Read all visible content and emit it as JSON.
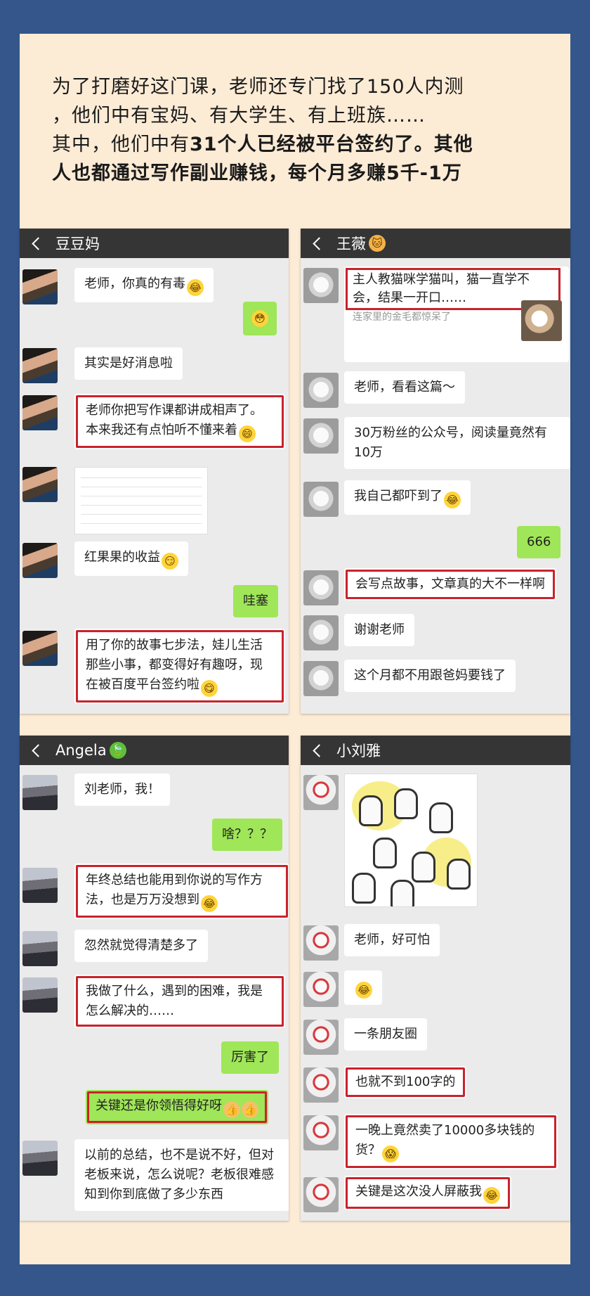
{
  "headline": {
    "line1": "为了打磨好这门课，老师还专门找了150人内测",
    "line2": "，他们中有宝妈、有大学生、有上班族……",
    "line3a": "其中，他们中有",
    "line3b": "31个人已经被平台签约了。其他",
    "line4": "人也都通过写作副业赚钱，每个月多赚5千-1万"
  },
  "panels": {
    "doudouma": {
      "title": "豆豆妈",
      "m1": "老师，你真的有毒",
      "m3": "其实是好消息啦",
      "m4": "老师你把写作课都讲成相声了。本来我还有点怕听不懂来着",
      "m6": "红果果的收益",
      "m7": "哇塞",
      "m8": "用了你的故事七步法，娃儿生活那些小事，都变得好有趣呀，现在被百度平台签约啦"
    },
    "wangwei": {
      "title": "王薇",
      "m1": "主人教猫咪学猫叫，猫一直学不会，结果一开口……",
      "m1_sub": "连家里的金毛都惊呆了",
      "m2": "老师，看看这篇～",
      "m3": "30万粉丝的公众号，阅读量竟然有10万",
      "m4": "我自己都吓到了",
      "m5": "666",
      "m6": "会写点故事，文章真的大不一样啊",
      "m7": "谢谢老师",
      "m8": "这个月都不用跟爸妈要钱了"
    },
    "angela": {
      "title": "Angela",
      "m1": "刘老师，我！",
      "m2": "啥？？？",
      "m3": "年终总结也能用到你说的写作方法，也是万万没想到",
      "m4": "忽然就觉得清楚多了",
      "m5": "我做了什么，遇到的困难，我是怎么解决的……",
      "m6": "厉害了",
      "m7": "关键还是你领悟得好呀",
      "m8": "以前的总结，也不是说不好，但对老板来说，怎么说呢？老板很难感知到你到底做了多少东西"
    },
    "xiaoliuya": {
      "title": "小刘雅",
      "m2": "老师，好可怕",
      "m4": "一条朋友圈",
      "m5": "也就不到100字的",
      "m6": "一晚上竟然卖了10000多块钱的货？",
      "m7": "关键是这次没人屏蔽我"
    }
  },
  "icons": [
    "back-arrow-icon",
    "cat-emoji-icon",
    "leaf-emoji-icon",
    "laughing-emoji-icon",
    "flushed-emoji-icon",
    "grinning-emoji-icon",
    "smirk-emoji-icon",
    "thumbs-up-icon",
    "screaming-emoji-icon"
  ],
  "colors": {
    "page_bg": "#34568b",
    "card_bg": "#fcebd5",
    "titlebar": "#353535",
    "chat_bg": "#ebebeb",
    "bubble_sent": "#9fe658",
    "highlight_box": "#c8232c"
  }
}
